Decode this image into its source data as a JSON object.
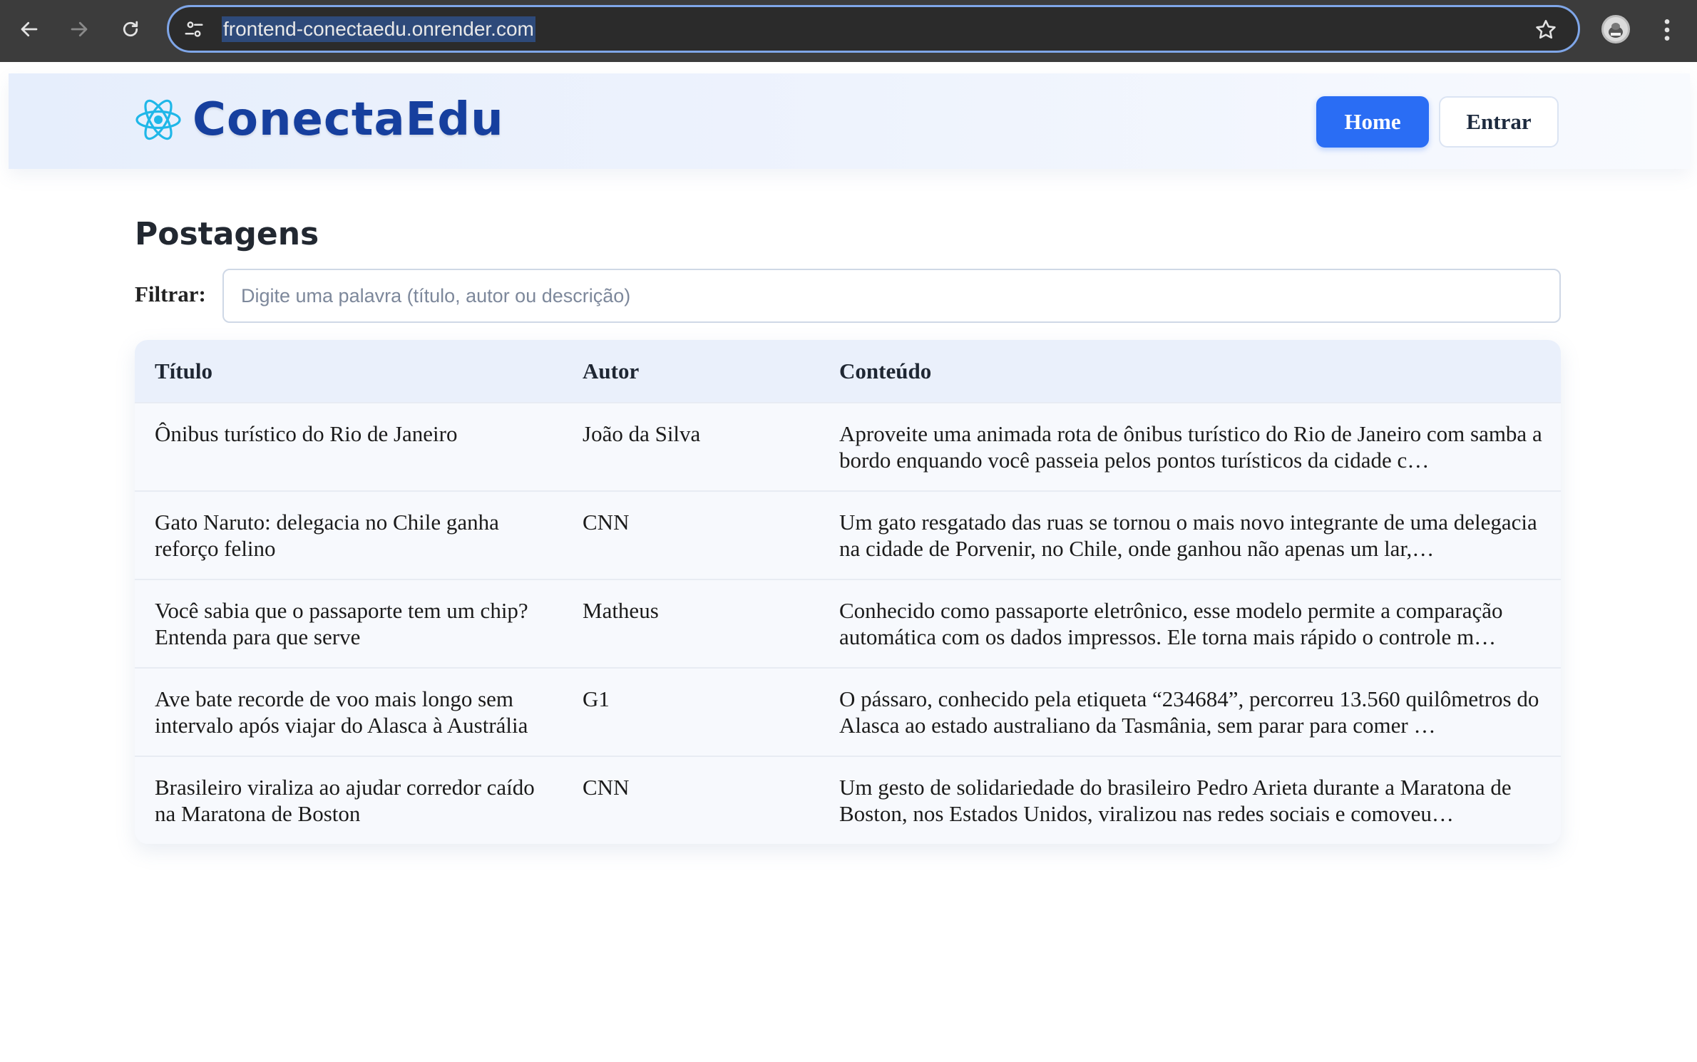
{
  "browser": {
    "url": "frontend-conectaedu.onrender.com",
    "icons": {
      "back": "arrow-left-icon",
      "forward": "arrow-right-icon",
      "reload": "reload-icon",
      "site_info": "tune-icon",
      "bookmark": "star-icon",
      "menu": "kebab-menu-icon"
    }
  },
  "header": {
    "brand": "ConectaEdu",
    "logo_icon": "atom-icon",
    "nav": {
      "home_label": "Home",
      "login_label": "Entrar"
    }
  },
  "main": {
    "title": "Postagens",
    "filter": {
      "label": "Filtrar:",
      "value": "",
      "placeholder": "Digite uma palavra (título, autor ou descrição)"
    },
    "table": {
      "headers": [
        "Título",
        "Autor",
        "Conteúdo"
      ],
      "rows": [
        {
          "title": "Ônibus turístico do Rio de Janeiro",
          "author": "João da Silva",
          "content": "Aproveite uma animada rota de ônibus turístico do Rio de Janeiro com samba a bordo enquando você passeia pelos pontos turísticos da cidade c…"
        },
        {
          "title": "Gato Naruto: delegacia no Chile ganha reforço felino",
          "author": "CNN",
          "content": "Um gato resgatado das ruas se tornou o mais novo integrante de uma delegacia na cidade de Porvenir, no Chile, onde ganhou não apenas um lar,…"
        },
        {
          "title": "Você sabia que o passaporte tem um chip? Entenda para que serve",
          "author": "Matheus",
          "content": "Conhecido como passaporte eletrônico, esse modelo permite a comparação automática com os dados impressos. Ele torna mais rápido o controle m…"
        },
        {
          "title": "Ave bate recorde de voo mais longo sem intervalo após viajar do Alasca à Austrália",
          "author": "G1",
          "content": "O pássaro, conhecido pela etiqueta “234684”, percorreu 13.560 quilômetros do Alasca ao estado australiano da Tasmânia, sem parar para comer …"
        },
        {
          "title": "Brasileiro viraliza ao ajudar corredor caído na Maratona de Boston",
          "author": "CNN",
          "content": "Um gesto de solidariedade do brasileiro Pedro Arieta durante a Maratona de Boston, nos Estados Unidos, viralizou nas redes sociais e comoveu…"
        }
      ]
    }
  },
  "colors": {
    "chrome_bg": "#3c3c3c",
    "brand": "#163f9e",
    "primary_button": "#2a6df4",
    "logo_icon": "#1fb7e8"
  }
}
